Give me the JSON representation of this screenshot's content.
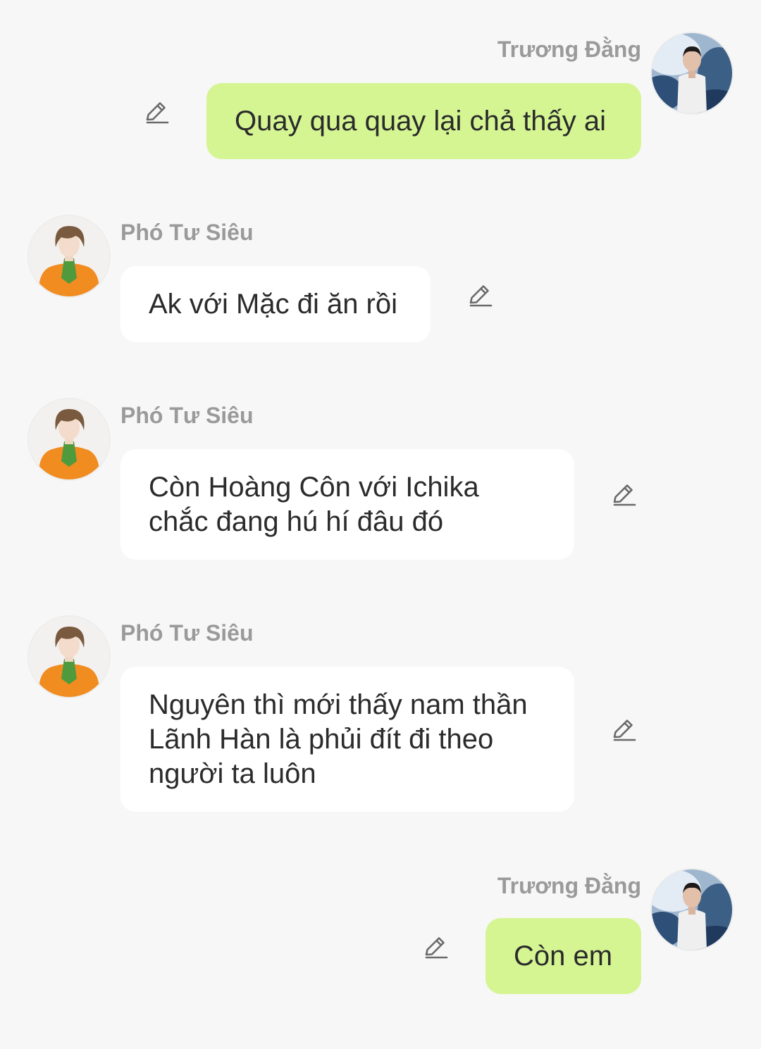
{
  "messages": [
    {
      "sender": "Trương Đằng",
      "text": "Quay qua quay lại chả thấy ai",
      "direction": "outgoing"
    },
    {
      "sender": "Phó Tư Siêu",
      "text": "Ak với Mặc đi ăn rồi",
      "direction": "incoming"
    },
    {
      "sender": "Phó Tư Siêu",
      "text": "Còn Hoàng Côn với Ichika chắc đang hú hí đâu đó",
      "direction": "incoming"
    },
    {
      "sender": "Phó Tư Siêu",
      "text": "Nguyên thì mới thấy nam thần Lãnh Hàn là phủi đít đi theo người ta luôn",
      "direction": "incoming"
    },
    {
      "sender": "Trương Đằng",
      "text": "Còn em",
      "direction": "outgoing"
    }
  ],
  "colors": {
    "background": "#f7f7f7",
    "outgoing_bubble": "#d5f593",
    "incoming_bubble": "#ffffff",
    "sender_name": "#9a9a9a",
    "message_text": "#2b2b2b"
  },
  "icons": {
    "edit": "pencil-icon",
    "avatar_outgoing": "avatar-truong-dang",
    "avatar_incoming": "avatar-pho-tu-sieu"
  }
}
